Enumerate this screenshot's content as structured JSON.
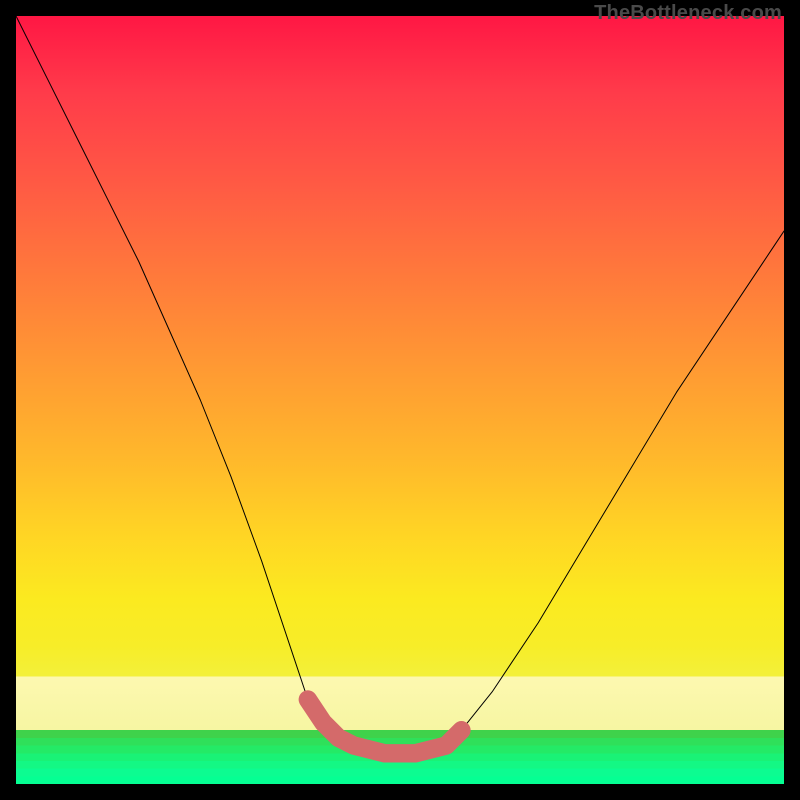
{
  "watermark": {
    "text": "TheBottleneck.com"
  },
  "colors": {
    "frame": "#000000",
    "curve_black": "#000000",
    "highlight_red": "#d46a6a",
    "gradient_top": "#ff1744",
    "gradient_mid": "#ffd624",
    "gradient_bottom": "#05ff93"
  },
  "chart_data": {
    "type": "line",
    "title": "",
    "xlabel": "",
    "ylabel": "",
    "xlim": [
      0,
      100
    ],
    "ylim": [
      0,
      100
    ],
    "series": [
      {
        "name": "bottleneck-curve",
        "x": [
          0,
          4,
          8,
          12,
          16,
          20,
          24,
          28,
          32,
          36,
          38,
          40,
          42,
          44,
          48,
          52,
          56,
          58,
          62,
          68,
          74,
          80,
          86,
          92,
          98,
          100
        ],
        "y": [
          100,
          92,
          84,
          76,
          68,
          59,
          50,
          40,
          29,
          17,
          11,
          8,
          6,
          5,
          4,
          4,
          5,
          7,
          12,
          21,
          31,
          41,
          51,
          60,
          69,
          72
        ]
      }
    ],
    "highlight_segment": {
      "name": "safe-zone",
      "x": [
        38,
        40,
        42,
        44,
        48,
        52,
        56,
        58
      ],
      "y": [
        11,
        8,
        6,
        5,
        4,
        4,
        5,
        7
      ]
    },
    "legend": [],
    "grid": false
  }
}
